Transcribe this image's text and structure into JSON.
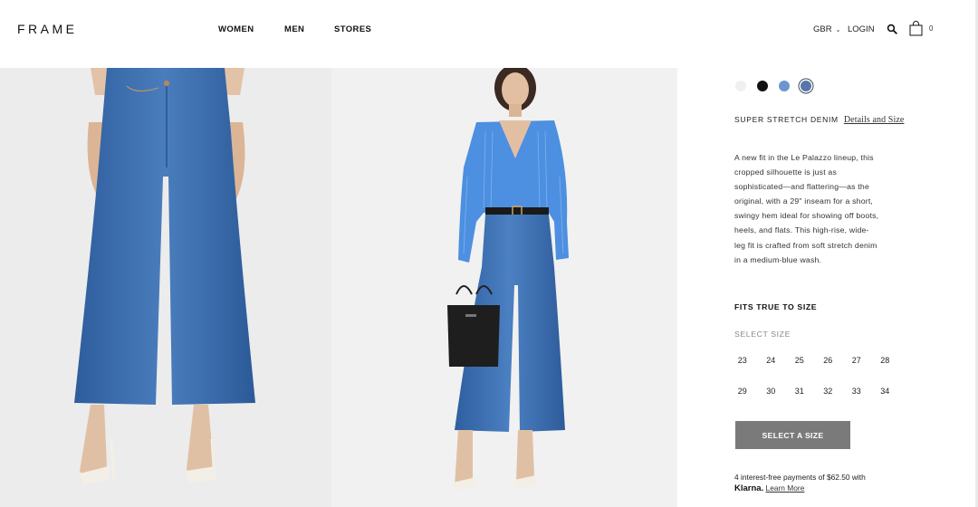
{
  "header": {
    "logo": "FRAME",
    "nav": {
      "women": "WOMEN",
      "men": "MEN",
      "stores": "STORES"
    },
    "country": "GBR",
    "country_chevron": "⌄",
    "login": "LOGIN",
    "bag_count": "0"
  },
  "product": {
    "colors": [
      {
        "name": "swatch-white",
        "hex": "#f0f0f0",
        "selected": false
      },
      {
        "name": "swatch-black",
        "hex": "#111111",
        "selected": false
      },
      {
        "name": "swatch-light-blue",
        "hex": "#6f95d0",
        "selected": false
      },
      {
        "name": "swatch-medium-blue",
        "hex": "#5677a8",
        "selected": true
      }
    ],
    "fabric": "SUPER STRETCH DENIM",
    "details_link": "Details and Size",
    "description": "A new fit in the Le Palazzo lineup, this cropped silhouette is just as sophisticated—and flattering—as the original, with a 29\" inseam for a short, swingy hem ideal for showing off boots, heels, and flats. This high-rise, wide-leg fit is crafted from soft stretch denim in a medium-blue wash.",
    "fit_note": "FITS TRUE TO SIZE",
    "select_size_label": "SELECT SIZE",
    "sizes": [
      "23",
      "24",
      "25",
      "26",
      "27",
      "28",
      "29",
      "30",
      "31",
      "32",
      "33",
      "34"
    ],
    "select_button": "SELECT A SIZE",
    "klarna": {
      "text": "4 interest-free payments of $62.50 with",
      "brand": "Klarna.",
      "link": "Learn More"
    }
  },
  "colors": {
    "denim": "#3d6fb0",
    "button_disabled": "#7a7a7a",
    "shirt": "#4d8fe0"
  }
}
